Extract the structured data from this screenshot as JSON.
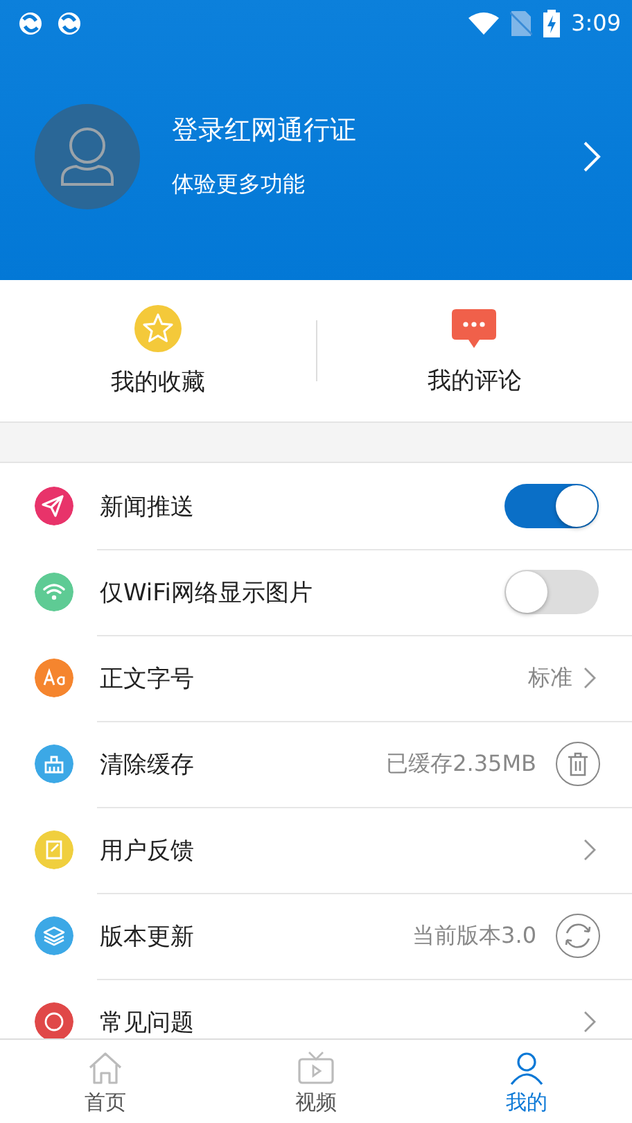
{
  "status_bar": {
    "time": "3:09"
  },
  "profile": {
    "title": "登录红网通行证",
    "subtitle": "体验更多功能"
  },
  "shortcuts": [
    {
      "label": "我的收藏"
    },
    {
      "label": "我的评论"
    }
  ],
  "settings": [
    {
      "kind": "toggle",
      "label": "新闻推送",
      "on": true,
      "color": "#e8336a"
    },
    {
      "kind": "toggle",
      "label": "仅WiFi网络显示图片",
      "on": false,
      "color": "#5ecb94"
    },
    {
      "kind": "select",
      "label": "正文字号",
      "value": "标准",
      "color": "#f5852e"
    },
    {
      "kind": "clear",
      "label": "清除缓存",
      "value": "已缓存2.35MB",
      "color": "#3ca8e6"
    },
    {
      "kind": "link",
      "label": "用户反馈",
      "color": "#f0cf3e"
    },
    {
      "kind": "update",
      "label": "版本更新",
      "value": "当前版本3.0",
      "color": "#3ca8e6"
    },
    {
      "kind": "link",
      "label": "常见问题",
      "color": "#e04848"
    }
  ],
  "tabs": [
    {
      "label": "首页",
      "selected": false
    },
    {
      "label": "视频",
      "selected": false
    },
    {
      "label": "我的",
      "selected": true
    }
  ]
}
